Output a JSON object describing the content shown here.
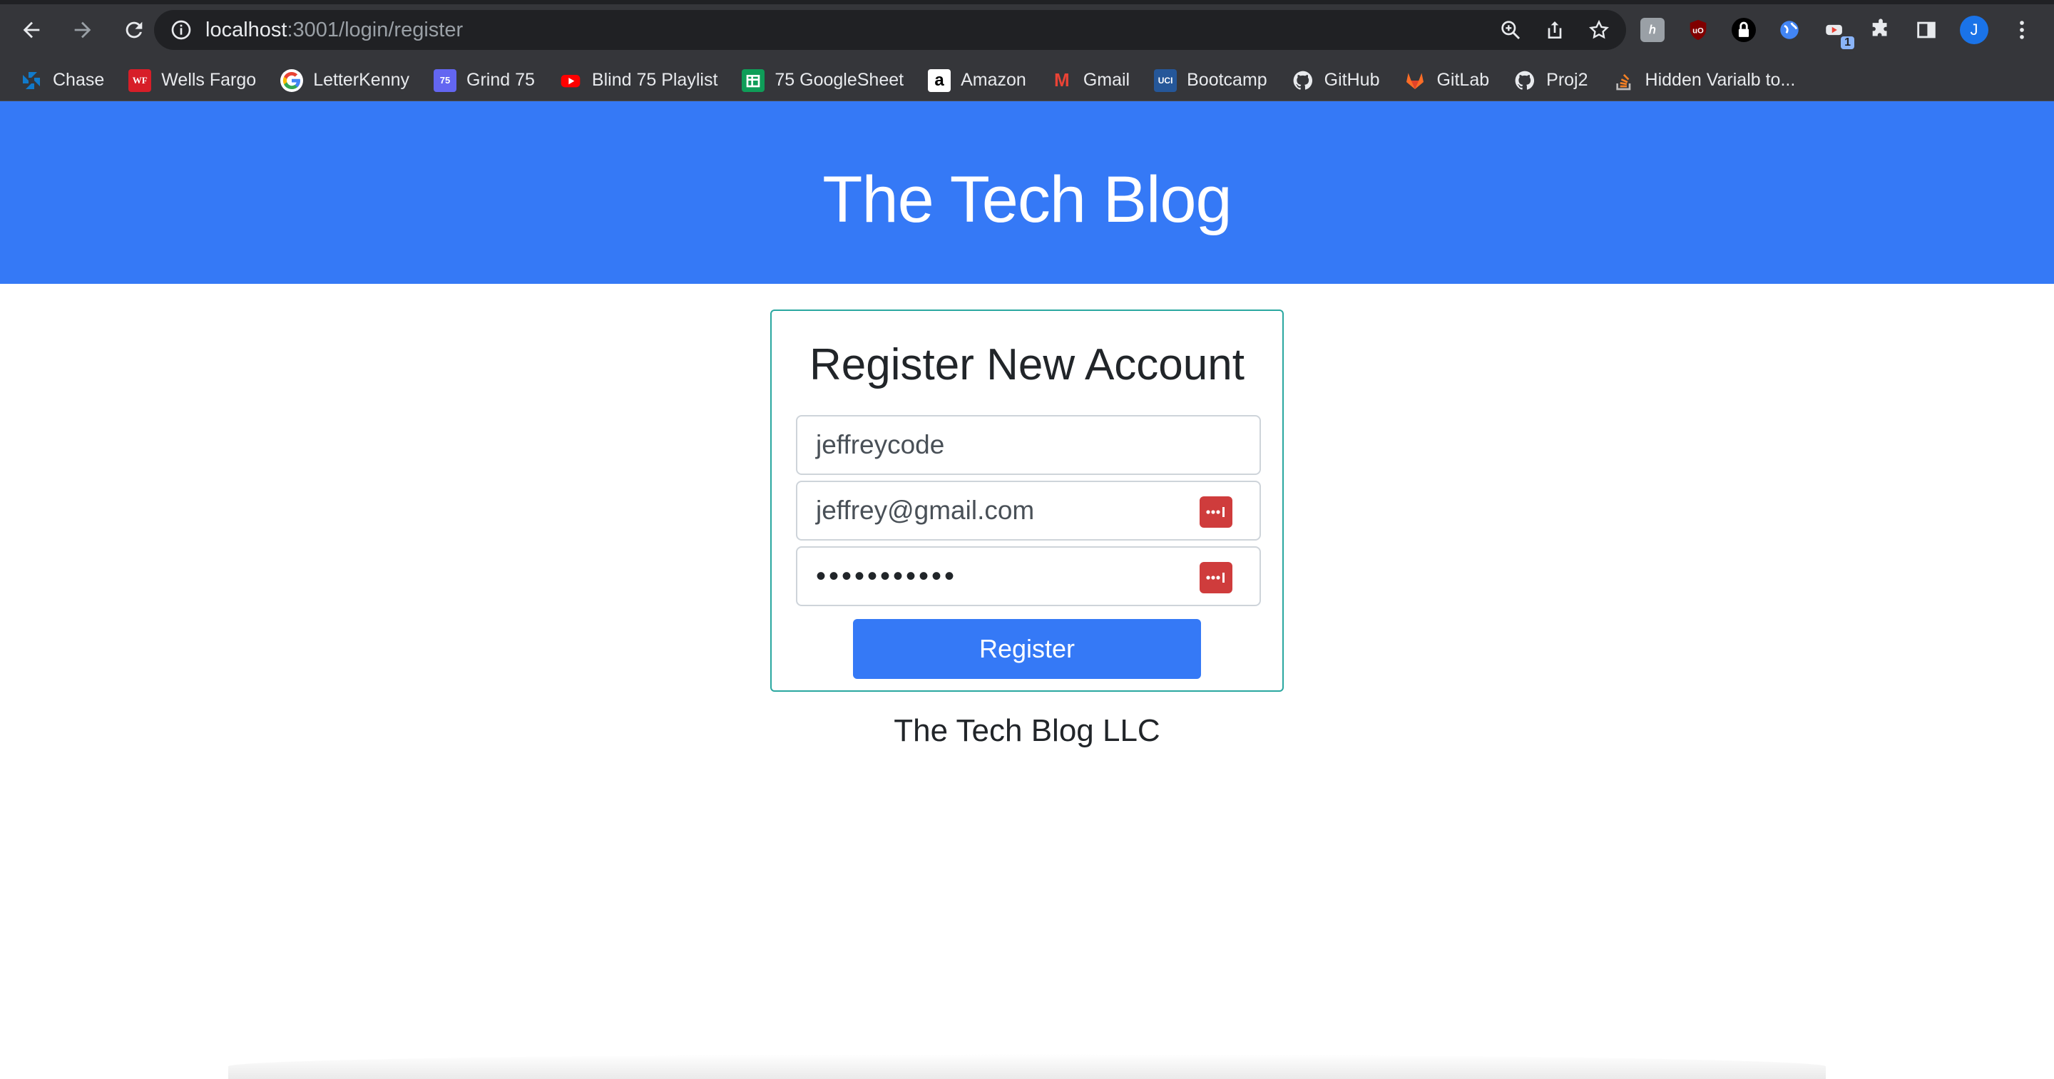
{
  "browser": {
    "url_host": "localhost",
    "url_path": ":3001/login/register",
    "profile_initial": "J",
    "extension_badge": "1",
    "bookmarks": [
      {
        "label": "Chase",
        "icon": "chase-icon",
        "color": "#117aca"
      },
      {
        "label": "Wells Fargo",
        "icon": "wells-fargo-icon",
        "color": "#d71e28",
        "glyph": "WF"
      },
      {
        "label": "LetterKenny",
        "icon": "google-icon",
        "color": "#ffffff"
      },
      {
        "label": "Grind 75",
        "icon": "grind75-icon",
        "color": "#6366f1",
        "glyph": "75"
      },
      {
        "label": "Blind 75 Playlist",
        "icon": "youtube-icon",
        "color": "#ff0000"
      },
      {
        "label": "75 GoogleSheet",
        "icon": "sheets-icon",
        "color": "#0f9d58"
      },
      {
        "label": "Amazon",
        "icon": "amazon-icon",
        "color": "#ffffff",
        "glyph": "a"
      },
      {
        "label": "Gmail",
        "icon": "gmail-icon",
        "color": "#ea4335",
        "glyph": "M"
      },
      {
        "label": "Bootcamp",
        "icon": "uci-icon",
        "color": "#255799",
        "glyph": "UCI"
      },
      {
        "label": "GitHub",
        "icon": "github-icon",
        "color": "#ffffff"
      },
      {
        "label": "GitLab",
        "icon": "gitlab-icon",
        "color": "#fc6d26"
      },
      {
        "label": "Proj2",
        "icon": "github-icon",
        "color": "#ffffff"
      },
      {
        "label": "Hidden Varialb to...",
        "icon": "stackoverflow-icon",
        "color": "#f48024"
      }
    ]
  },
  "page": {
    "header_title": "The Tech Blog",
    "form": {
      "title": "Register New Account",
      "username_value": "jeffreycode",
      "email_value": "jeffrey@gmail.com",
      "password_value": "•••••••••••",
      "submit_label": "Register"
    },
    "footer": "The Tech Blog LLC"
  },
  "colors": {
    "accent": "#3579f6",
    "card_border": "#2aa7a0",
    "password_manager": "#cf3c3c"
  }
}
